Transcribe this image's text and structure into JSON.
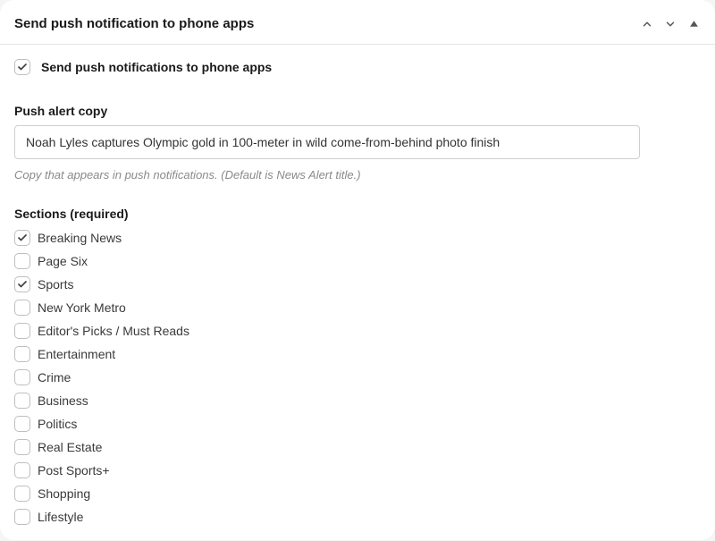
{
  "header": {
    "title": "Send push notification to phone apps"
  },
  "main_toggle": {
    "label": "Send push notifications to phone apps",
    "checked": true
  },
  "push_copy": {
    "label": "Push alert copy",
    "value": "Noah Lyles captures Olympic gold in 100-meter in wild come-from-behind photo finish",
    "help": "Copy that appears in push notifications. (Default is News Alert title.)"
  },
  "sections": {
    "label": "Sections (required)",
    "items": [
      {
        "label": "Breaking News",
        "checked": true
      },
      {
        "label": "Page Six",
        "checked": false
      },
      {
        "label": "Sports",
        "checked": true
      },
      {
        "label": "New York Metro",
        "checked": false
      },
      {
        "label": "Editor's Picks / Must Reads",
        "checked": false
      },
      {
        "label": "Entertainment",
        "checked": false
      },
      {
        "label": "Crime",
        "checked": false
      },
      {
        "label": "Business",
        "checked": false
      },
      {
        "label": "Politics",
        "checked": false
      },
      {
        "label": "Real Estate",
        "checked": false
      },
      {
        "label": "Post Sports+",
        "checked": false
      },
      {
        "label": "Shopping",
        "checked": false
      },
      {
        "label": "Lifestyle",
        "checked": false
      }
    ]
  }
}
